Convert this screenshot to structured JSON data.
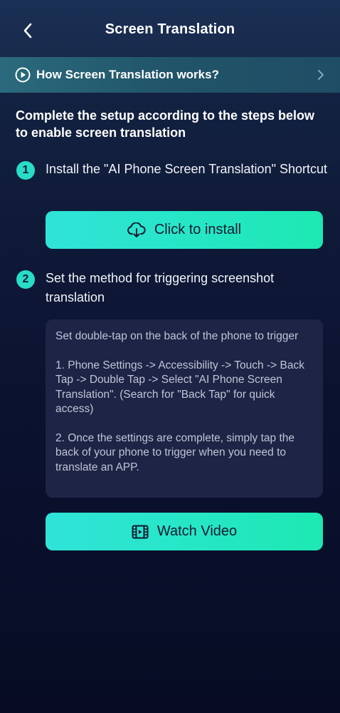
{
  "header": {
    "title": "Screen Translation",
    "back_icon": "chevron-left-icon"
  },
  "how_banner": {
    "label": "How Screen Translation works?",
    "leading_icon": "play-circle-icon",
    "trailing_icon": "chevron-right-icon"
  },
  "intro": "Complete the setup according to the steps below to enable screen translation",
  "steps": [
    {
      "number": "1",
      "text": "Install the \"AI Phone Screen Translation\" Shortcut",
      "button": {
        "label": "Click to install",
        "icon": "cloud-download-icon"
      }
    },
    {
      "number": "2",
      "text": "Set the method for triggering screenshot translation",
      "info": [
        "Set double-tap on the back of the phone to trigger",
        "1. Phone Settings -> Accessibility -> Touch -> Back Tap -> Double Tap -> Select \"AI Phone Screen Translation\". (Search for \"Back Tap\" for quick access)",
        "2. Once the settings are complete, simply tap the back of your phone to trigger when you need to translate an APP."
      ],
      "button": {
        "label": "Watch Video",
        "icon": "film-icon"
      }
    }
  ],
  "colors": {
    "accent": "#28dcc6",
    "button_gradient_start": "#30e3d8",
    "button_gradient_end": "#1de8b2",
    "background_top": "#17284a",
    "background_bottom": "#070c24",
    "banner": "#215468",
    "info_box": "#1d2445"
  }
}
